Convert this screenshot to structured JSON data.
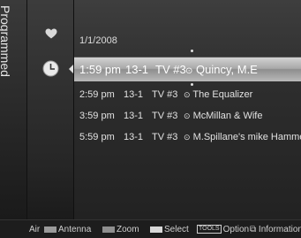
{
  "sidebar": {
    "tab_label": "Programmed"
  },
  "list": {
    "date": "1/1/2008",
    "rows": [
      {
        "time": "1:59 pm",
        "channel": "13-1",
        "type": "TV #3",
        "title": "Quincy, M.E",
        "selected": true
      },
      {
        "time": "2:59 pm",
        "channel": "13-1",
        "type": "TV #3",
        "title": "The Equalizer",
        "selected": false
      },
      {
        "time": "3:59 pm",
        "channel": "13-1",
        "type": "TV #3",
        "title": "McMillan & Wife",
        "selected": false
      },
      {
        "time": "5:59 pm",
        "channel": "13-1",
        "type": "TV #3",
        "title": "M.Spillane's mike Hamme",
        "selected": false
      }
    ],
    "row_icon": "clock-icon"
  },
  "icons": {
    "favorites": "heart-icon",
    "schedule": "clock-icon"
  },
  "bottom_bar": {
    "air": "Air",
    "antenna": "Antenna",
    "zoom": "Zoom",
    "select": "Select",
    "tools_tag": "TOOLS",
    "option": "Option",
    "information": "Information"
  },
  "colors": {
    "red_key": "#9a9a9a",
    "green_key": "#8f8f8f",
    "yellow_key": "#d8d8d8",
    "selection": "#bdbdbd"
  }
}
